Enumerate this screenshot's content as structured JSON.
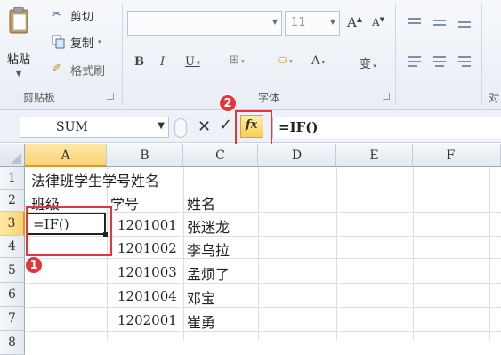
{
  "ribbon": {
    "clipboard": {
      "paste_label": "粘贴",
      "cut_label": "剪切",
      "copy_label": "复制",
      "format_painter_label": "格式刷",
      "group_label": "剪贴板"
    },
    "font": {
      "font_name": "",
      "font_size": "11",
      "grow_label": "A",
      "shrink_label": "A",
      "bold_label": "B",
      "italic_label": "I",
      "underline_label": "U",
      "font_color_label": "A",
      "phonetic_label": "变",
      "group_label": "字体"
    },
    "alignment": {
      "group_label": "对"
    }
  },
  "formula_bar": {
    "name_box": "SUM",
    "cancel_label": "✕",
    "enter_label": "✓",
    "fx_label": "fx",
    "formula": "=IF()"
  },
  "grid": {
    "columns": [
      "A",
      "B",
      "C",
      "D",
      "E",
      "F"
    ],
    "rows": [
      "1",
      "2",
      "3",
      "4",
      "5",
      "6",
      "7",
      "8"
    ],
    "cells": {
      "A1": "法律班学生学号姓名",
      "A2": "班级",
      "B2": "学号",
      "C2": "姓名",
      "A3": "=IF()",
      "B3": "1201001",
      "C3": "张迷龙",
      "B4": "1201002",
      "C4": "李乌拉",
      "B5": "1201003",
      "C5": "孟烦了",
      "B6": "1201004",
      "C6": "邓宝",
      "B7": "1202001",
      "C7": "崔勇"
    }
  },
  "annotations": {
    "step1": "1",
    "step2": "2",
    "accent_color": "#e5353a"
  }
}
